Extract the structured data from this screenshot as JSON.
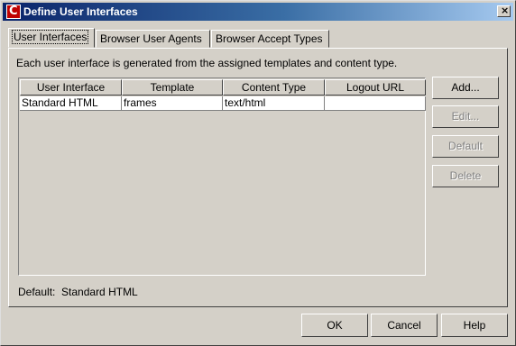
{
  "window": {
    "title": "Define User Interfaces",
    "close_glyph": "×",
    "app_icon_letter": "C"
  },
  "tabs": [
    {
      "label": "User Interfaces",
      "active": true
    },
    {
      "label": "Browser User Agents",
      "active": false
    },
    {
      "label": "Browser Accept Types",
      "active": false
    }
  ],
  "description": "Each user interface is generated from the assigned templates and content type.",
  "table": {
    "columns": [
      "User Interface",
      "Template",
      "Content Type",
      "Logout URL"
    ],
    "rows": [
      [
        "Standard HTML",
        "frames",
        "text/html",
        ""
      ]
    ]
  },
  "side_buttons": {
    "add": "Add...",
    "edit": "Edit...",
    "default": "Default",
    "delete": "Delete"
  },
  "default_label": "Default:",
  "default_value": "Standard HTML",
  "bottom_buttons": {
    "ok": "OK",
    "cancel": "Cancel",
    "help": "Help"
  }
}
